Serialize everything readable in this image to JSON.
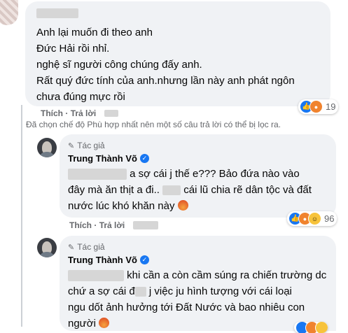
{
  "comment1": {
    "lines": [
      "Anh lại muốn đi theo anh",
      "Đức Hải rồi nhỉ.",
      "nghệ sĩ người công chúng đấy anh.",
      "Rất quý đức tính của anh.nhưng lần này anh phát ngôn",
      "chưa đúng mực rồi"
    ],
    "like_label": "Thích",
    "reply_label": "Trả lời",
    "reaction_count": "19"
  },
  "filter_notice": "Đã chọn chế độ Phù hợp nhất nên một số câu trả lời có thể bị lọc ra.",
  "reply1": {
    "author_tag": "Tác giả",
    "author_name": "Trung Thành Võ",
    "lines": [
      "a sợ cái j thế e??? Bảo đứa nào vào",
      "đây mà ăn thịt a đi..",
      "cái lũ chia rẽ dân tộc và đất",
      "nước lúc khó khăn này"
    ],
    "like_label": "Thích",
    "reply_label": "Trả lời",
    "reaction_count": "96"
  },
  "reply2": {
    "author_tag": "Tác giả",
    "author_name": "Trung Thành Võ",
    "lines": [
      "khi cần a còn cầm súng ra chiến trường dc",
      "chứ a sợ cái đ",
      "j việc ju hình tượng với cái loại",
      "ngu dốt ảnh hưởng tới Đất Nước và bao nhiêu con",
      "người"
    ]
  }
}
